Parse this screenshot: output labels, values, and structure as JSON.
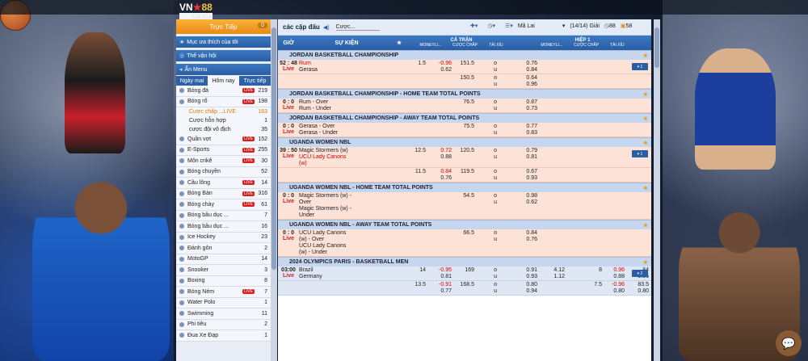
{
  "brand": {
    "vn": "VN",
    "num": "88",
    "sub": "LALIGA"
  },
  "sidebar": {
    "live_label": "Trực Tiếp",
    "live_count": "0",
    "fav_label": "Mục ưa thích của tôi",
    "sports_label": "Thể vận hội",
    "menu_label": "Ẩn Menu",
    "tabs": [
      "Ngày mai",
      "Hôm nay",
      "Trực tiếp"
    ],
    "sports": [
      {
        "name": "Bóng đá",
        "live": true,
        "count": "219"
      },
      {
        "name": "Bóng rổ",
        "live": true,
        "count": "198"
      }
    ],
    "subs": [
      {
        "name": "Cược chấp ...",
        "live": true,
        "count": "163"
      },
      {
        "name": "Cược hỗn hợp",
        "count": "1"
      },
      {
        "name": "cược đội vô địch",
        "count": "35"
      }
    ],
    "sports2": [
      {
        "name": "Quần vợt",
        "live": true,
        "count": "152"
      },
      {
        "name": "E-Sports",
        "live": true,
        "count": "255"
      },
      {
        "name": "Môn crikê",
        "live": true,
        "count": "30"
      },
      {
        "name": "Bóng chuyền",
        "count": "52"
      },
      {
        "name": "Cầu lông",
        "live": true,
        "count": "14"
      },
      {
        "name": "Bóng Bàn",
        "live": true,
        "count": "316"
      },
      {
        "name": "Bóng chày",
        "live": true,
        "count": "61"
      },
      {
        "name": "Bóng bầu dục ...",
        "count": "7"
      },
      {
        "name": "Bóng bầu dục ...",
        "count": "16"
      },
      {
        "name": "Ice Hockey",
        "count": "23"
      },
      {
        "name": "Đánh gôn",
        "count": "2"
      },
      {
        "name": "MotoGP",
        "count": "14"
      },
      {
        "name": "Snooker",
        "count": "3"
      },
      {
        "name": "Boxing",
        "count": "8"
      },
      {
        "name": "Bóng Ném",
        "live": true,
        "count": "7"
      },
      {
        "name": "Water Polo",
        "count": "1"
      },
      {
        "name": "Swimming",
        "count": "11"
      },
      {
        "name": "Phi tiêu",
        "count": "2"
      },
      {
        "name": "Đua Xe Đạp",
        "count": "1"
      }
    ],
    "live_badge": "LIVE"
  },
  "toolbar": {
    "title": "các cặp đấu",
    "odds": "Cược...",
    "odds_type": "Mã Lai",
    "pages": "(14/14) Giải",
    "c88": "88",
    "c58": "58"
  },
  "header": {
    "time": "GIỜ",
    "event": "SỰ KIỆN",
    "full": "CẢ TRẬN",
    "half": "HIỆP 1",
    "cols": [
      "MONEYLI...",
      "CƯỢC CHẤP",
      "TÀI XỈU",
      "MONEYLI...",
      "CƯỢC CHẤP",
      "TÀI XỈU"
    ]
  },
  "leagues": [
    {
      "name": "JORDAN BASKETBALL CHAMPIONSHIP"
    },
    {
      "name": "JORDAN BASKETBALL CHAMPIONSHIP - HOME TEAM TOTAL POINTS"
    },
    {
      "name": "JORDAN BASKETBALL CHAMPIONSHIP - AWAY TEAM TOTAL POINTS"
    },
    {
      "name": "UGANDA WOMEN NBL"
    },
    {
      "name": "UGANDA WOMEN NBL - HOME TEAM TOTAL POINTS"
    },
    {
      "name": "UGANDA WOMEN NBL - AWAY TEAM TOTAL POINTS"
    },
    {
      "name": "2024 OLYMPICS PARIS - BASKETBALL MEN"
    }
  ],
  "rows": {
    "r1": {
      "t1": "52 : 48",
      "t2": "Live",
      "a": "Rum",
      "b": "Gerasa",
      "hc": "1.5",
      "o1": "-0.96",
      "o2": "0.62",
      "tl": "151.5",
      "u": "u",
      "o": "o",
      "x1": "0.76",
      "x2": "0.84",
      "btn": "▾ 1"
    },
    "r1b": {
      "tl": "150.5",
      "x1": "0.64",
      "x2": "0.96"
    },
    "r2": {
      "t1": "0 : 0",
      "t2": "Live",
      "a": "Rum - Over",
      "b": "Rum - Under",
      "tl": "76.5",
      "x1": "0.87",
      "x2": "0.73"
    },
    "r3": {
      "t1": "0 : 0",
      "t2": "Live",
      "a": "Gerasa - Over",
      "b": "Gerasa - Under",
      "tl": "75.5",
      "x1": "0.77",
      "x2": "0.83"
    },
    "r4": {
      "t1": "39 : 50",
      "t2": "Live",
      "a": "Magic Stormers (w)",
      "b": "UCU Lady Canons",
      "c": "(w)",
      "hc": "12.5",
      "o1": "0.72",
      "o2": "0.88",
      "tl": "120.5",
      "x1": "0.79",
      "x2": "0.81",
      "btn": "▾ 1"
    },
    "r4b": {
      "hc": "11.5",
      "o1": "0.84",
      "o2": "0.76",
      "tl": "119.5",
      "x1": "0.67",
      "x2": "0.93"
    },
    "r5": {
      "t1": "0 : 0",
      "t2": "Live",
      "a": "Magic Stormers (w) -",
      "b": "Over",
      "c": "Magic Stormers (w) -",
      "d": "Under",
      "tl": "54.5",
      "x1": "0.98",
      "x2": "0.62"
    },
    "r6": {
      "t1": "0 : 0",
      "t2": "Live",
      "a": "UCU Lady Canons",
      "b": "(w) - Over",
      "c": "UCU Lady Canons",
      "d": "(w) - Under",
      "tl": "66.5",
      "x1": "0.84",
      "x2": "0.76"
    },
    "r7": {
      "t1": "03:00",
      "t2": "Live",
      "a": "Brazil",
      "b": "Germany",
      "hc": "14",
      "o1": "-0.95",
      "o2": "0.81",
      "tl": "169",
      "x1": "0.91",
      "x2": "0.93",
      "m1": "4.12",
      "m2": "1.12",
      "hc2": "8",
      "h1": "0.96",
      "h2": "0.88",
      "tl2": "84",
      "hx1": "0.86",
      "hx2": "0.96",
      "btn": "▾ 2"
    },
    "r7b": {
      "hc": "13.5",
      "o1": "-0.91",
      "o2": "0.77",
      "tl": "168.5",
      "x1": "0.80",
      "x2": "0.94",
      "hc2": "7.5",
      "h1": "-0.96",
      "h2": "0.80",
      "tl2": "83.5",
      "hx1": "0.80",
      "hx2": "-0.98"
    }
  },
  "colors": {
    "accent": "#2a5ea4",
    "live": "#d62020",
    "odds_neg": "#d00",
    "row_pink": "#fde2d8",
    "row_blue": "#dfe7f5"
  }
}
